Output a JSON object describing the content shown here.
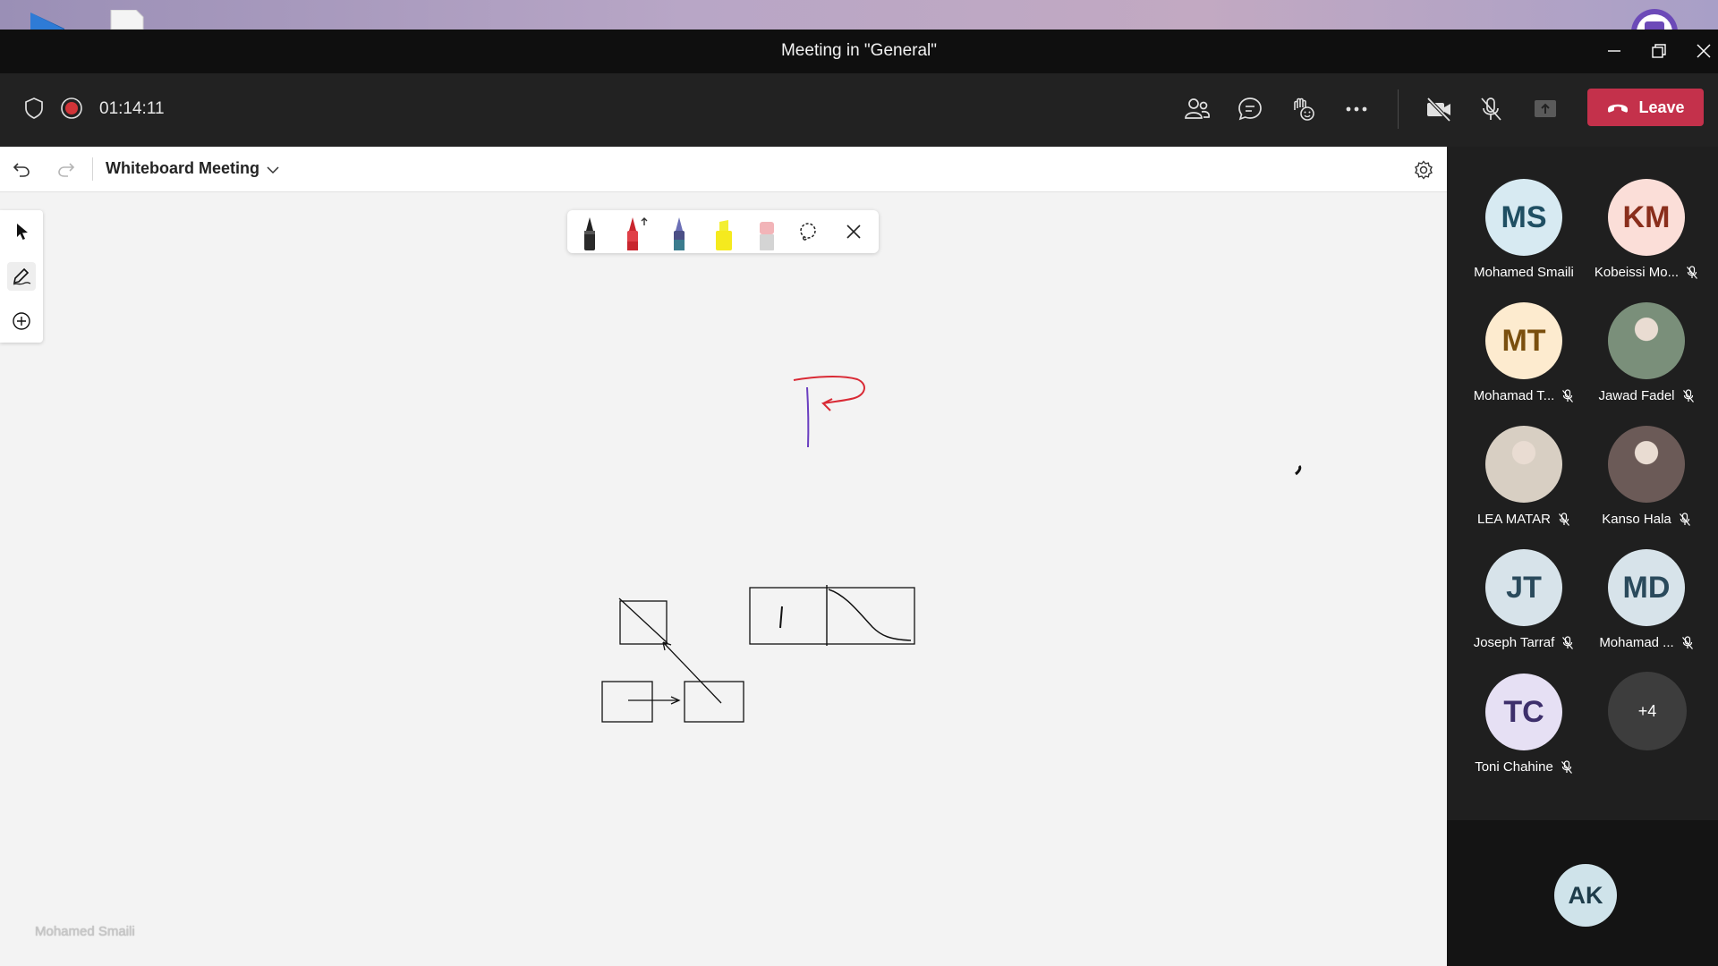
{
  "window": {
    "title": "Meeting in \"General\""
  },
  "callbar": {
    "timer": "01:14:11",
    "leave_label": "Leave",
    "icons": [
      "shield-icon",
      "record-icon",
      "people-icon",
      "chat-icon",
      "reactions-icon",
      "more-icon",
      "camera-off-icon",
      "mic-off-icon",
      "share-icon",
      "phone-hangup-icon"
    ]
  },
  "whiteboard": {
    "title": "Whiteboard Meeting",
    "pen_tray": [
      "black-pen",
      "red-pen",
      "galaxy-pen",
      "yellow-highlighter",
      "eraser",
      "lasso",
      "close"
    ],
    "watermark": "Mohamed Smaili"
  },
  "participants": [
    {
      "initials": "MS",
      "name": "Mohamed Smaili",
      "muted": false,
      "bg": "#d7eaf2",
      "fg": "#1f4f63"
    },
    {
      "initials": "KM",
      "name": "Kobeissi Mo...",
      "muted": true,
      "bg": "#fbded8",
      "fg": "#8a2e1c"
    },
    {
      "initials": "MT",
      "name": "Mohamad T...",
      "muted": true,
      "bg": "#fdebcf",
      "fg": "#7a4f0e"
    },
    {
      "initials": "",
      "name": "Jawad Fadel",
      "muted": true,
      "bg": "#7a8f7a",
      "fg": "#ffffff",
      "photo": true
    },
    {
      "initials": "",
      "name": "LEA MATAR",
      "muted": true,
      "bg": "#d8cfc3",
      "fg": "#ffffff",
      "photo": true
    },
    {
      "initials": "",
      "name": "Kanso Hala",
      "muted": true,
      "bg": "#6b5a57",
      "fg": "#ffffff",
      "photo": true
    },
    {
      "initials": "JT",
      "name": "Joseph Tarraf",
      "muted": true,
      "bg": "#d7e3ea",
      "fg": "#2a4a5c"
    },
    {
      "initials": "MD",
      "name": "Mohamad ...",
      "muted": true,
      "bg": "#d7e3ea",
      "fg": "#2a4a5c"
    },
    {
      "initials": "TC",
      "name": "Toni Chahine",
      "muted": true,
      "bg": "#e6e0f4",
      "fg": "#3d2f6b"
    }
  ],
  "more_count": "+4",
  "self_initials": "AK",
  "colors": {
    "leave": "#c4314b",
    "callbar": "#222222",
    "roster": "#1f1f1f",
    "accent": "#6264a7"
  }
}
